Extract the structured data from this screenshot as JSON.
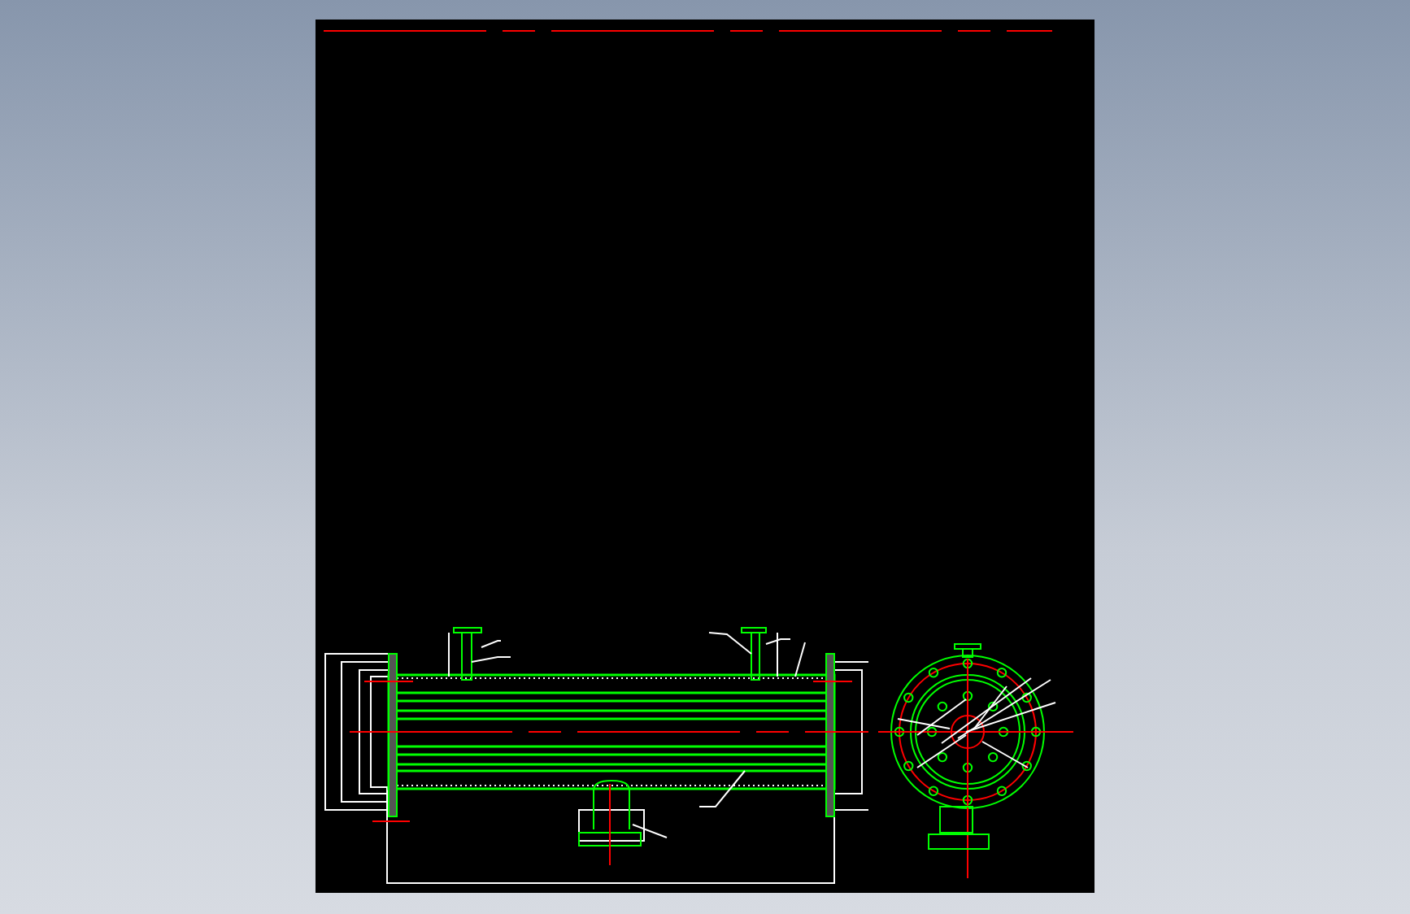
{
  "sheet": {
    "kind": "cad"
  }
}
